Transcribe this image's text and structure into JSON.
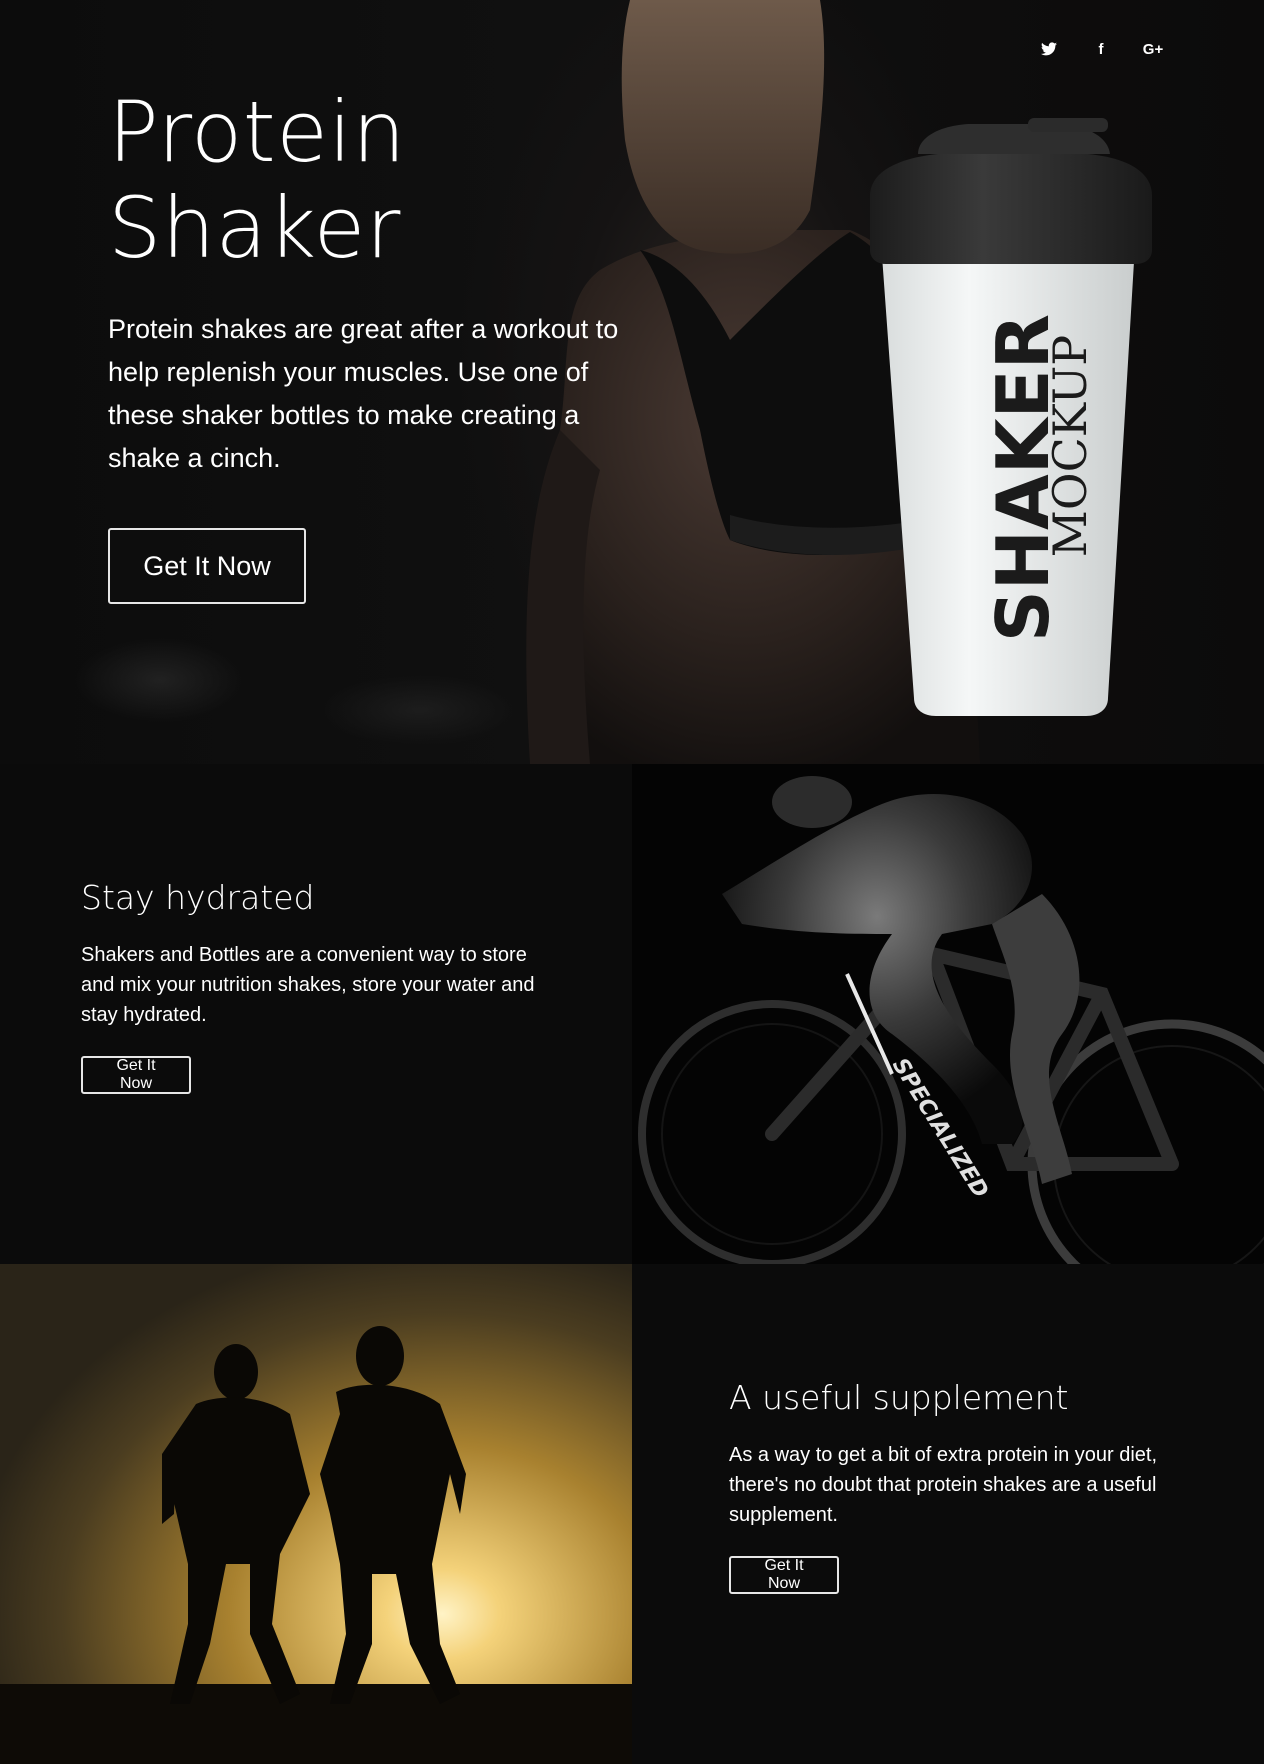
{
  "hero": {
    "title_line1": "Protein",
    "title_line2": "Shaker",
    "description": "Protein shakes are great after a workout to help replenish your muscles. Use one of these shaker bottles to make creating a shake a cinch.",
    "button_label": "Get It Now",
    "bottle_brand": "SHAKER",
    "bottle_sub": "MOCKUP"
  },
  "social": {
    "icons": [
      "twitter-icon",
      "facebook-icon",
      "google-plus-icon"
    ],
    "twitter_glyph": "🐦",
    "facebook_glyph": "f",
    "google_glyph": "G+"
  },
  "features": [
    {
      "title": "Stay hydrated",
      "body": "Shakers and Bottles are a convenient way to store and mix your nutrition shakes, store your water and stay hydrated.",
      "button_label": "Get It Now",
      "bike_brand": "SPECIALIZED"
    },
    {
      "title": "A useful supplement",
      "body": "As a way to get a bit of extra protein in your diet, there's no doubt that protein shakes are a useful supplement.",
      "button_label": "Get It Now"
    }
  ],
  "colors": {
    "background": "#0b0b0b",
    "text": "#ffffff",
    "button_border": "#e6e6e6",
    "bottle_cap": "#2a2a2a",
    "bottle_body": "#f2f4f4",
    "sunset": "#d9a441"
  }
}
